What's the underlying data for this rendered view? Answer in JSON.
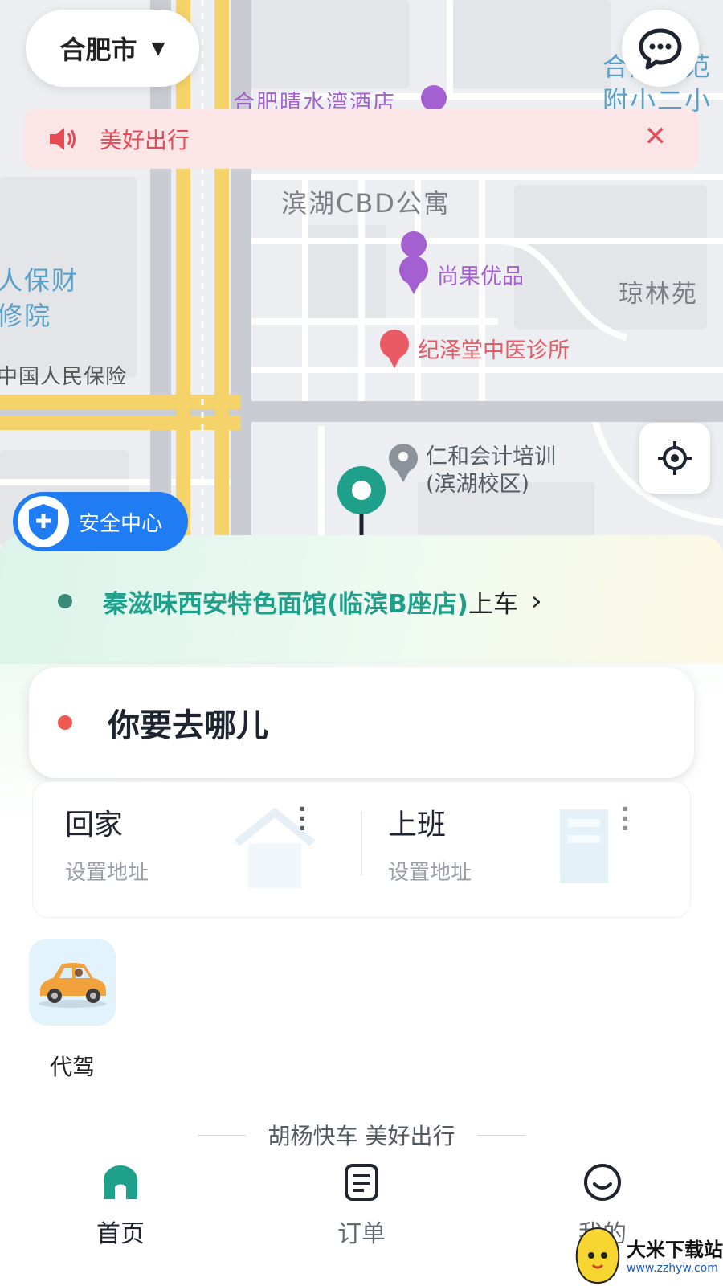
{
  "colors": {
    "accent": "#1ea08a",
    "notice_bg": "#fbe5e7",
    "notice_text": "#e84a55",
    "safety_blue": "#1f7cf2",
    "dest_dot": "#ee5a52"
  },
  "map": {
    "labels": {
      "hotel": "合肥晴水湾酒店",
      "apartment": "滨湖CBD公寓",
      "insurance_a": "人保财",
      "insurance_b": "修院",
      "insurance_c": "中国人民保险",
      "school_a": "合肥师范",
      "school_b": "附小二小",
      "qionglin": "琼林苑",
      "fruit_shop": "尚果优品",
      "clinic": "纪泽堂中医诊所",
      "training_a": "仁和会计培训",
      "training_b": "(滨湖校区)"
    }
  },
  "top": {
    "city": "合肥市",
    "city_caret": "▼"
  },
  "notice": {
    "text": "美好出行",
    "close": "✕"
  },
  "safety": {
    "label": "安全中心"
  },
  "pickup": {
    "place": "秦滋味西安特色面馆(临滨B座店)",
    "suffix": "上车",
    "chevron": "›"
  },
  "destination": {
    "placeholder": "你要去哪儿"
  },
  "quick": {
    "home": {
      "label": "回家",
      "sub": "设置地址"
    },
    "work": {
      "label": "上班",
      "sub": "设置地址"
    }
  },
  "service": {
    "label": "代驾"
  },
  "slogan": "胡杨快车 美好出行",
  "tabs": [
    {
      "label": "首页",
      "icon": "home-icon",
      "active": true
    },
    {
      "label": "订单",
      "icon": "order-icon",
      "active": false
    },
    {
      "label": "我的",
      "icon": "profile-icon",
      "active": false
    }
  ],
  "watermark": {
    "line1": "大米下载站",
    "line2": "www.zzhyw.com"
  }
}
